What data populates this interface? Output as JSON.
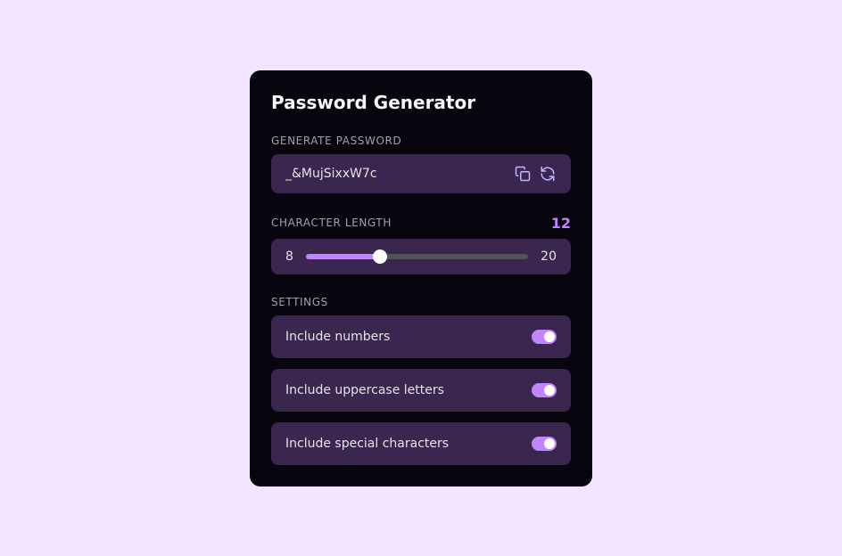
{
  "title": "Password Generator",
  "generate": {
    "label": "GENERATE PASSWORD",
    "value": "_&MujSixxW7c"
  },
  "length": {
    "label": "CHARACTER LENGTH",
    "value": "12",
    "min": "8",
    "max": "20"
  },
  "settings": {
    "label": "SETTINGS",
    "options": [
      {
        "label": "Include numbers",
        "enabled": true
      },
      {
        "label": "Include uppercase letters",
        "enabled": true
      },
      {
        "label": "Include special characters",
        "enabled": true
      }
    ]
  }
}
